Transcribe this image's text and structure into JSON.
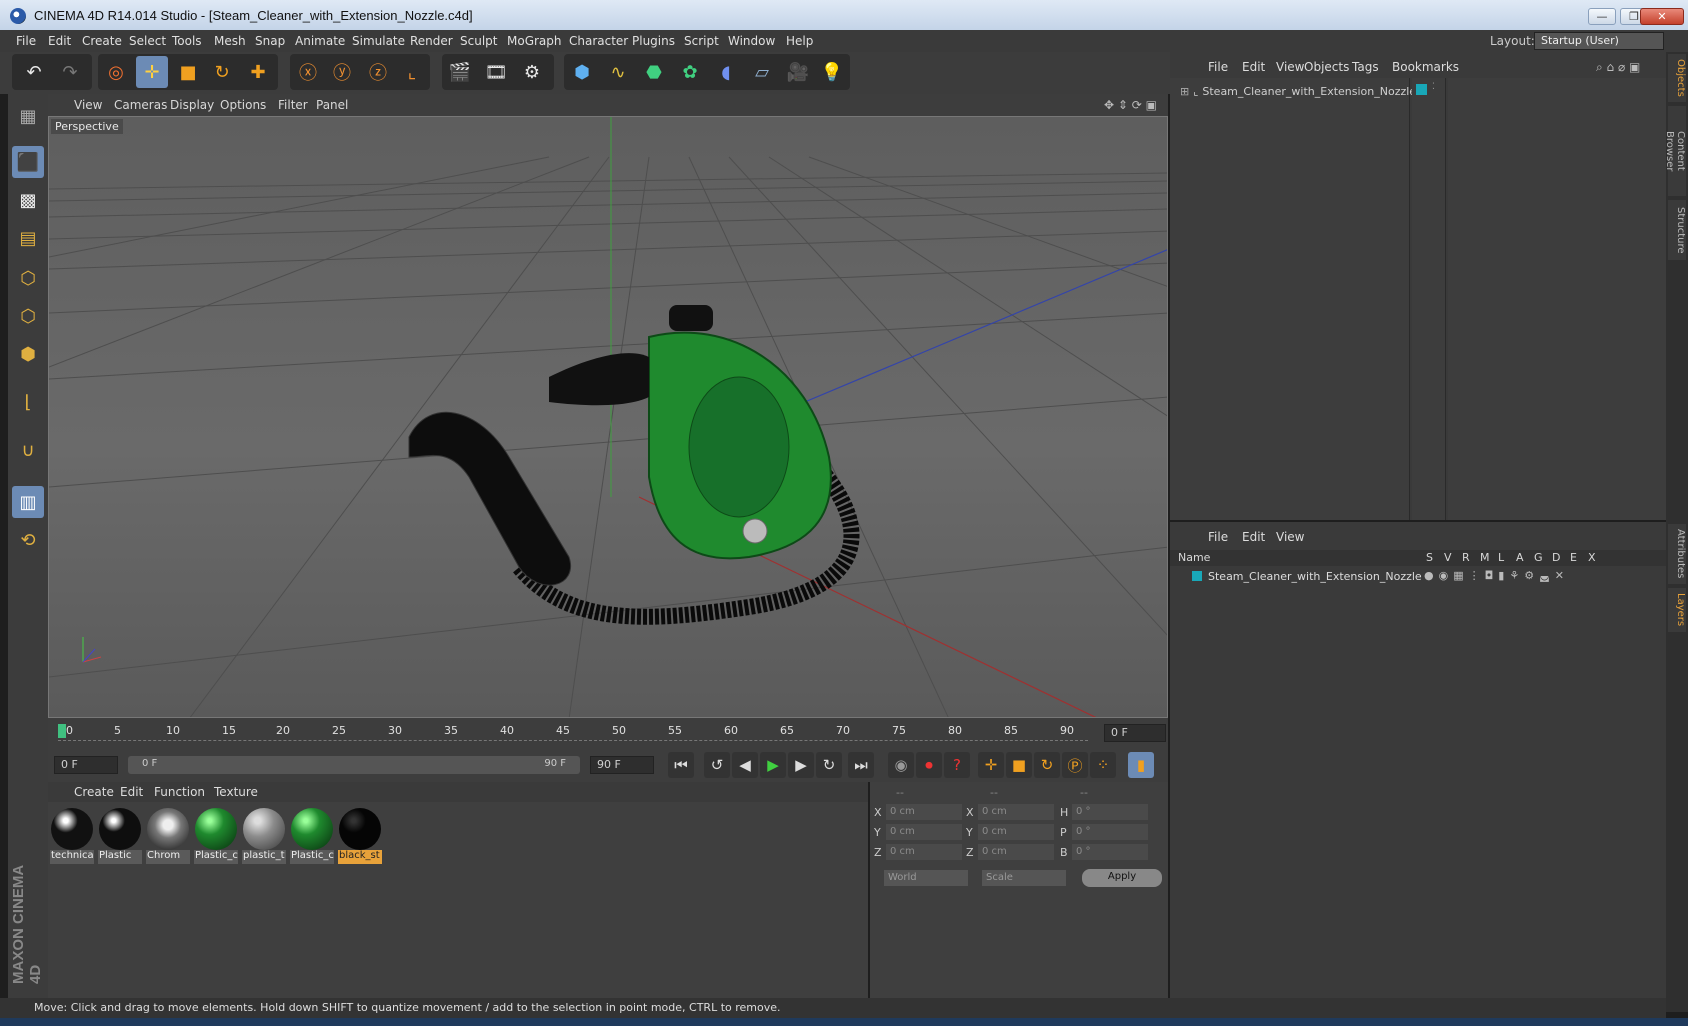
{
  "window": {
    "title": "CINEMA 4D R14.014 Studio - [Steam_Cleaner_with_Extension_Nozzle.c4d]",
    "minimize": "—",
    "maximize": "❐",
    "close": "✕"
  },
  "menubar": {
    "items": [
      "File",
      "Edit",
      "Create",
      "Select",
      "Tools",
      "Mesh",
      "Snap",
      "Animate",
      "Simulate",
      "Render",
      "Sculpt",
      "MoGraph",
      "Character",
      "Plugins",
      "Script",
      "Window",
      "Help"
    ],
    "layout_label": "Layout:",
    "layout_value": "Startup (User)"
  },
  "viewport": {
    "menu": [
      "View",
      "Cameras",
      "Display",
      "Options",
      "Filter",
      "Panel"
    ],
    "label": "Perspective"
  },
  "timeline": {
    "ticks": [
      "0",
      "5",
      "10",
      "15",
      "20",
      "25",
      "30",
      "35",
      "40",
      "45",
      "50",
      "55",
      "60",
      "65",
      "70",
      "75",
      "80",
      "85",
      "90"
    ],
    "current_frame": "0 F"
  },
  "transport": {
    "start_field": "0 F",
    "range_start": "0 F",
    "range_end": "90 F",
    "end_field": "90 F"
  },
  "materials": {
    "menu": [
      "Create",
      "Edit",
      "Function",
      "Texture"
    ],
    "items": [
      {
        "label": "technica",
        "color": "#111111"
      },
      {
        "label": "Plastic",
        "color": "#0e0e0e"
      },
      {
        "label": "Chrom",
        "color": "#9a9a9a"
      },
      {
        "label": "Plastic_c",
        "color": "#1f8a2e"
      },
      {
        "label": "plastic_t",
        "color": "#8c8c8c"
      },
      {
        "label": "Plastic_c",
        "color": "#1f8a2e"
      },
      {
        "label": "black_st",
        "color": "#050505"
      }
    ]
  },
  "coords": {
    "headers": [
      "--",
      "--",
      "--"
    ],
    "rows": [
      {
        "a": "X",
        "av": "0 cm",
        "b": "X",
        "bv": "0 cm",
        "c": "H",
        "cv": "0 °"
      },
      {
        "a": "Y",
        "av": "0 cm",
        "b": "Y",
        "bv": "0 cm",
        "c": "P",
        "cv": "0 °"
      },
      {
        "a": "Z",
        "av": "0 cm",
        "b": "Z",
        "bv": "0 cm",
        "c": "B",
        "cv": "0 °"
      }
    ],
    "world": "World",
    "scale": "Scale",
    "apply": "Apply"
  },
  "object_manager": {
    "menu": [
      "File",
      "Edit",
      "View",
      "Objects",
      "Tags",
      "Bookmarks"
    ],
    "object_name": "Steam_Cleaner_with_Extension_Nozzle",
    "tag_color": "#19a8b8"
  },
  "layer_manager": {
    "menu": [
      "File",
      "Edit",
      "View"
    ],
    "columns": [
      "Name",
      "S",
      "V",
      "R",
      "M",
      "L",
      "A",
      "G",
      "D",
      "E",
      "X"
    ],
    "layer_name": "Steam_Cleaner_with_Extension_Nozzle"
  },
  "side_tabs": [
    "Objects",
    "Content Browser",
    "Structure",
    "Attributes",
    "Layers"
  ],
  "status": {
    "text": "Move: Click and drag to move elements. Hold down SHIFT to quantize movement / add to the selection in point mode, CTRL to remove."
  },
  "brand": "MAXON CINEMA 4D",
  "colors": {
    "accent": "#6c8bb5",
    "highlight": "#e8a23a",
    "green": "#1f8a2e"
  }
}
